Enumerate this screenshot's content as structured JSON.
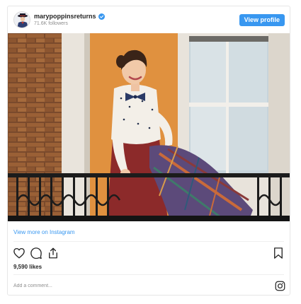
{
  "post": {
    "username": "marypoppinsreturns",
    "followers": "71.6K followers",
    "view_profile_label": "View profile",
    "verified_icon": "verified-badge-icon",
    "brand_color": "#3897f0"
  },
  "footer": {
    "view_more_label": "View more on Instagram",
    "likes": "9,590 likes",
    "comment_placeholder": "Add a comment...",
    "icons": [
      "heart-icon",
      "comment-icon",
      "share-icon",
      "bookmark-icon",
      "instagram-icon"
    ]
  }
}
